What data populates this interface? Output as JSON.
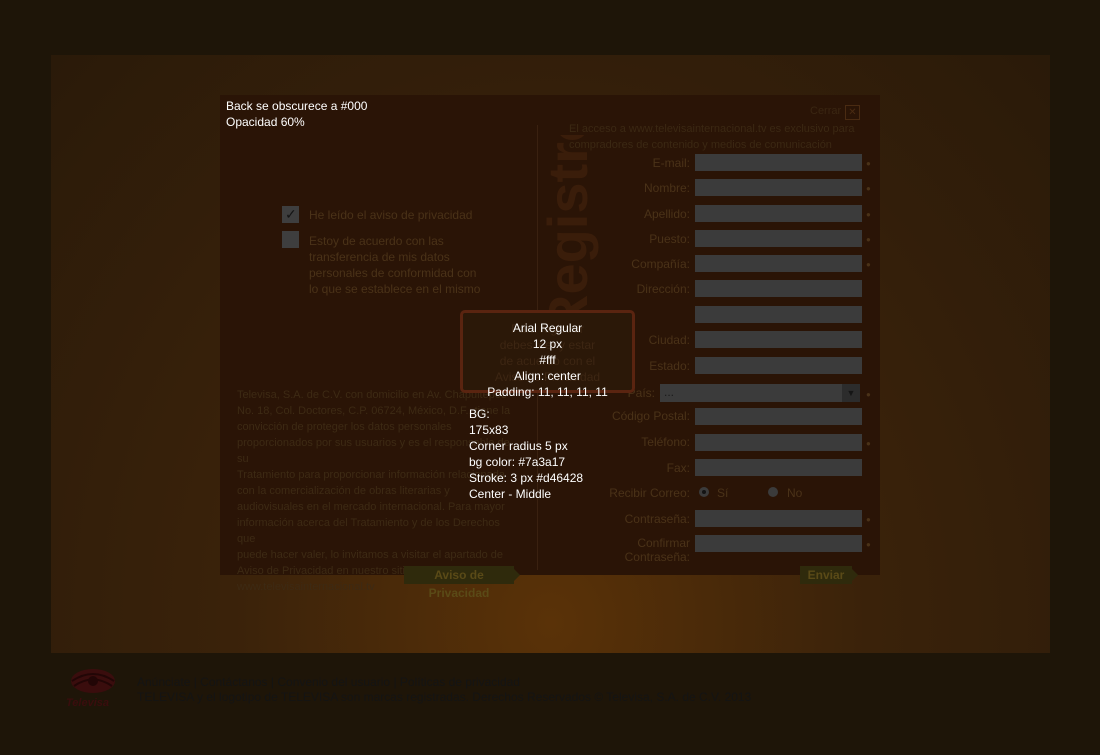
{
  "annotations": {
    "backdrop_line1": "Back se obscurece a #000",
    "backdrop_line2": "Opacidad 60%",
    "font_lines": [
      "Arial Regular",
      "12 px",
      "#fff",
      "Align: center",
      "Padding: 11, 11, 11, 11"
    ],
    "bg_lines": [
      "BG:",
      "175x83",
      "Corner radius 5 px",
      "bg color: #7a3a17",
      "Stroke: 3 px #d46428",
      "Center - Middle"
    ]
  },
  "dialog": {
    "close_label": "Cerrar",
    "watermark": "Registro"
  },
  "left": {
    "checkbox1_label": "He leído el aviso de privacidad",
    "checkbox1_checked": true,
    "checkbox2_lines": [
      "Estoy de acuerdo con las",
      "transferencia de mis datos",
      "personales de conformidad con",
      "lo que se establece en el mismo"
    ],
    "checkbox2_checked": false,
    "privacy_lines": [
      "Televisa, S.A. de C.V. con domicilio en Av. Chapultepec",
      "No. 18, Col. Doctores, C.P. 06724, México, D.F., tiene la",
      "convicción de proteger los datos personales",
      "proporcionados por sus usuarios y es el responsable de su",
      "Tratamiento para proporcionar información relacionada",
      "con la comercialización de obras literarias y",
      "audiovisuales en el mercado internacional. Para mayor",
      "información acerca del Tratamiento y de los Derechos que",
      "puede hacer valer, lo invitamos a visitar el apartado de",
      "Aviso de Privacidad en nuestro sitio de Internet",
      "www.televisainternacional.tv"
    ],
    "privacy_button": "Aviso de Privacidad"
  },
  "form": {
    "intro_lines": [
      "El acceso a www.televisainternacional.tv es exclusivo para",
      "compradores de contenido y medios de comunicación"
    ],
    "fields": [
      {
        "label": "E-mail:",
        "required": true
      },
      {
        "label": "Nombre:",
        "required": true
      },
      {
        "label": "Apellido:",
        "required": true
      },
      {
        "label": "Puesto:",
        "required": true
      },
      {
        "label": "Compañía:",
        "required": true
      },
      {
        "label": "Dirección:",
        "required": false
      },
      {
        "label": "",
        "required": false
      },
      {
        "label": "Ciudad:",
        "required": false
      },
      {
        "label": "Estado:",
        "required": false
      }
    ],
    "country_label": "País:",
    "country_value": "...",
    "fields2": [
      {
        "label": "Código Postal:",
        "required": false
      },
      {
        "label": "Teléfono:",
        "required": true
      },
      {
        "label": "Fax:",
        "required": false
      }
    ],
    "mail_label": "Recibir Correo:",
    "mail_yes": "Sí",
    "mail_no": "No",
    "password_label": "Contraseña:",
    "confirm_label": "Confirmar Contraseña:",
    "submit": "Enviar"
  },
  "modal": {
    "lines": [
      "Para registrar",
      "debes leer y estar",
      "de acuerdo con el",
      "Aviso de Privacidad"
    ]
  },
  "footer": {
    "links": [
      "Anúnciate",
      "Contáctanos",
      "Convenio del usuario",
      "Políticas de privacidad"
    ],
    "copyright": "TELEVISA y el logotipo de TELEVISA son marcas registradas. Derechos Reservados © Televisa, S.A. de C.V. 2013",
    "logo_text": "Televisa"
  }
}
